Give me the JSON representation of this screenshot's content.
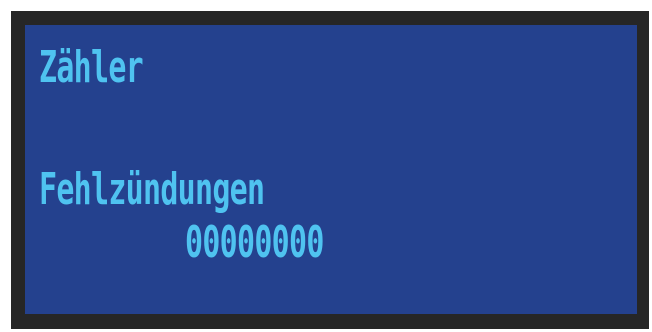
{
  "display": {
    "title": "Zähler",
    "counter_label": "Fehlzündungen",
    "counter_value": "00000000"
  },
  "colors": {
    "bezel": "#262626",
    "screen_background": "#24418e",
    "text": "#4fc3f0"
  }
}
